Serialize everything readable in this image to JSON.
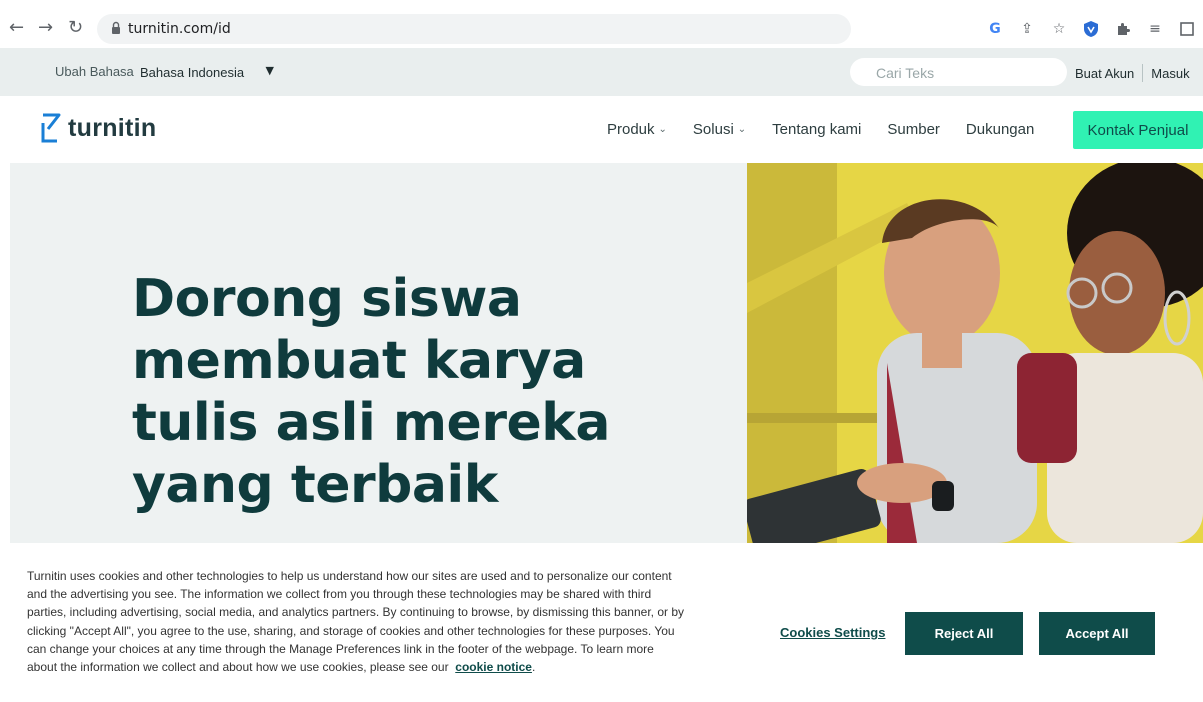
{
  "browser": {
    "url": "turnitin.com/id",
    "icons": [
      "back-icon",
      "forward-icon",
      "reload-icon",
      "lock-icon",
      "google-icon",
      "share-icon",
      "star-icon",
      "shield-extension-icon",
      "puzzle-icon",
      "reading-list-icon",
      "sidepanel-icon"
    ]
  },
  "utility_bar": {
    "language_label": "Ubah Bahasa",
    "language_selected": "Bahasa Indonesia",
    "search_placeholder": "Cari Teks",
    "create_account": "Buat Akun",
    "sign_in": "Masuk"
  },
  "nav": {
    "logo_text": "turnitin",
    "items": [
      {
        "label": "Produk",
        "has_dropdown": true
      },
      {
        "label": "Solusi",
        "has_dropdown": true
      },
      {
        "label": "Tentang kami",
        "has_dropdown": false
      },
      {
        "label": "Sumber",
        "has_dropdown": false
      },
      {
        "label": "Dukungan",
        "has_dropdown": false
      }
    ],
    "cta_label": "Kontak Penjual"
  },
  "hero": {
    "title": "Dorong siswa membuat karya tulis asli mereka yang terbaik"
  },
  "cookie_banner": {
    "text": "Turnitin uses cookies and other technologies to help us understand how our sites are used and to personalize our content and the advertising you see. The information we collect from you through these technologies may be shared with third parties, including advertising, social media, and analytics partners. By continuing to browse, by dismissing this banner, or by clicking \"Accept All\", you agree to the use, sharing, and storage of cookies and other technologies for these purposes. You can change your choices at any time through the Manage Preferences link in the footer of the webpage. To learn more about the information we collect and about how we use cookies, please see our",
    "link_label": "cookie notice",
    "settings_label": "Cookies Settings",
    "reject_label": "Reject All",
    "accept_label": "Accept All"
  },
  "colors": {
    "brand_dark": "#0f4c4a",
    "cta_green": "#30f2b3",
    "hero_bg": "#eef2f2",
    "util_bg": "#e9eeee"
  }
}
